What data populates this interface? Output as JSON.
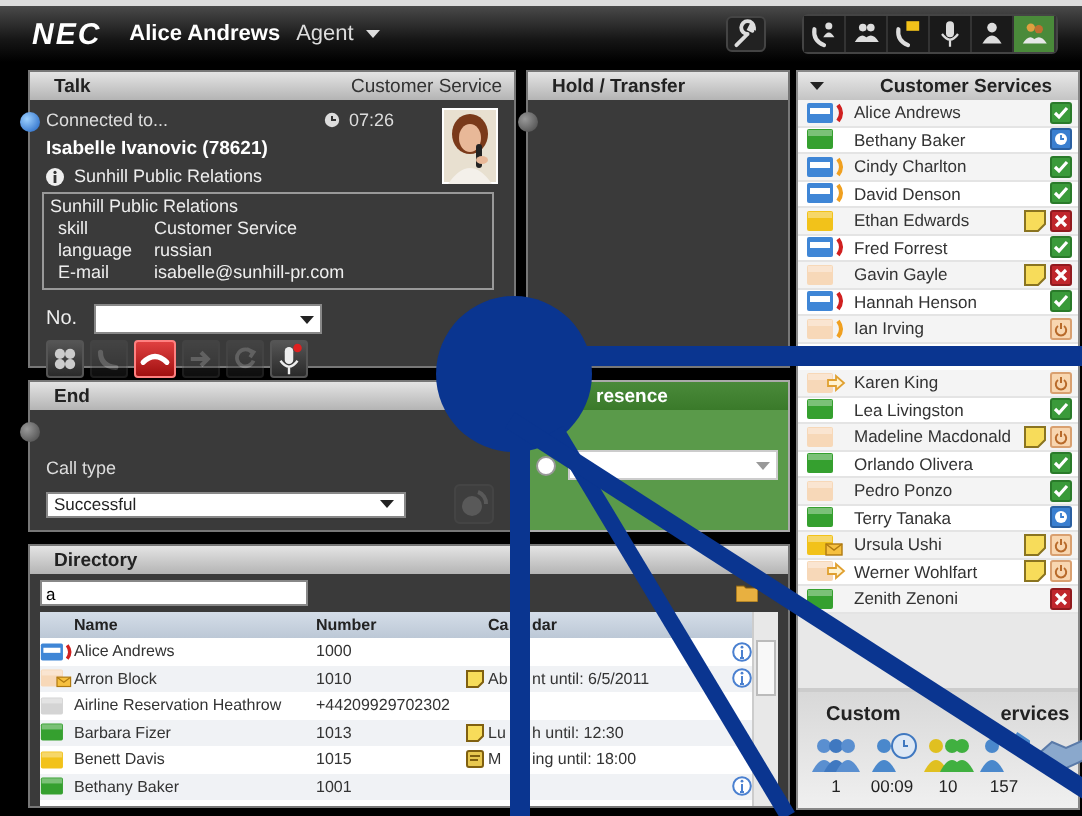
{
  "topbar": {
    "logo": "NEC",
    "user": "Alice Andrews",
    "role": "Agent",
    "tools": [
      {
        "kind": "wrench",
        "selected": false
      }
    ],
    "modes": [
      {
        "kind": "phone-person",
        "selected": false
      },
      {
        "kind": "group",
        "selected": false
      },
      {
        "kind": "phone-mail",
        "selected": false
      },
      {
        "kind": "mic",
        "selected": false
      },
      {
        "kind": "person",
        "selected": false
      },
      {
        "kind": "team",
        "selected": true
      }
    ]
  },
  "talk": {
    "title": "Talk",
    "queue": "Customer Service",
    "active": true,
    "status": "Connected to...",
    "duration": "07:26",
    "caller": "Isabelle Ivanovic (78621)",
    "company": "Sunhill Public Relations",
    "details": {
      "heading": "Sunhill Public Relations",
      "fields": [
        {
          "label": "skill",
          "value": "Customer Service"
        },
        {
          "label": "language",
          "value": "russian"
        },
        {
          "label": "E-mail",
          "value": "isabelle@sunhill-pr.com"
        }
      ]
    },
    "number_label": "No.",
    "controls": [
      {
        "kind": "dialpad",
        "disabled": false
      },
      {
        "kind": "answer",
        "disabled": true
      },
      {
        "kind": "hangup",
        "disabled": false
      },
      {
        "kind": "forward",
        "disabled": true
      },
      {
        "kind": "transfer",
        "disabled": true
      },
      {
        "kind": "mic",
        "disabled": false
      }
    ]
  },
  "hold": {
    "title": "Hold / Transfer",
    "active": false
  },
  "end": {
    "title": "End",
    "active": false,
    "call_type_label": "Call type",
    "call_type": "Successful",
    "button_disabled": true
  },
  "presence": {
    "title": "resence",
    "radio_checked": false
  },
  "directory": {
    "title": "Directory",
    "search": "a",
    "columns": [
      "Name",
      "Number"
    ],
    "calendar_column": [
      "Ca",
      "dar"
    ],
    "rows": [
      {
        "name": "Alice Andrews",
        "number": "1000",
        "color": "#3f86d6",
        "call": {
          "kind": "red"
        },
        "info": true
      },
      {
        "name": "Arron Block",
        "number": "1010",
        "color": "#f7d8b8",
        "call": {
          "kind": "mail"
        },
        "calendar": {
          "kind": "note",
          "parts": [
            "Ab",
            "nt until: 6/5/2011"
          ]
        },
        "info": true
      },
      {
        "name": "Airline Reservation Heathrow",
        "number": "+44209929702302",
        "color": "#d4d4d4",
        "info": false
      },
      {
        "name": "Barbara Fizer",
        "number": "1013",
        "color": "#35a02f",
        "calendar": {
          "kind": "note",
          "parts": [
            "Lu",
            "h until: 12:30"
          ]
        },
        "info": false
      },
      {
        "name": "Benett Davis",
        "number": "1015",
        "color": "#f2c21a",
        "calendar": {
          "kind": "meeting",
          "parts": [
            "M",
            "ing until: 18:00"
          ]
        },
        "info": false
      },
      {
        "name": "Bethany Baker",
        "number": "1001",
        "color": "#35a02f",
        "info": true
      }
    ]
  },
  "queue": {
    "title": "Customer Services",
    "expanded": true,
    "agents": [
      {
        "kind": "agent",
        "name": "Alice Andrews",
        "color": "#3f86d6",
        "call": {
          "kind": "red"
        },
        "note": false,
        "status": {
          "kind": "available"
        }
      },
      {
        "kind": "agent",
        "name": "Bethany Baker",
        "color": "#35a02f",
        "note": false,
        "status": {
          "kind": "scheduled"
        }
      },
      {
        "kind": "agent",
        "name": "Cindy Charlton",
        "color": "#3f86d6",
        "call": {
          "kind": "orange"
        },
        "note": false,
        "status": {
          "kind": "available"
        }
      },
      {
        "kind": "agent",
        "name": "David Denson",
        "color": "#3f86d6",
        "call": {
          "kind": "orange"
        },
        "note": false,
        "status": {
          "kind": "available"
        }
      },
      {
        "kind": "agent",
        "name": "Ethan Edwards",
        "color": "#f2c21a",
        "note": true,
        "status": {
          "kind": "busy"
        }
      },
      {
        "kind": "agent",
        "name": "Fred Forrest",
        "color": "#3f86d6",
        "call": {
          "kind": "red"
        },
        "note": false,
        "status": {
          "kind": "available"
        }
      },
      {
        "kind": "agent",
        "name": "Gavin Gayle",
        "color": "#f7d8b8",
        "note": true,
        "status": {
          "kind": "busy"
        }
      },
      {
        "kind": "agent",
        "name": "Hannah Henson",
        "color": "#3f86d6",
        "call": {
          "kind": "red"
        },
        "note": false,
        "status": {
          "kind": "available"
        }
      },
      {
        "kind": "agent",
        "name": "Ian Irving",
        "color": "#f7d8b8",
        "call": {
          "kind": "orange"
        },
        "note": false,
        "status": {
          "kind": "off"
        }
      },
      {
        "kind": "covered"
      },
      {
        "kind": "agent",
        "name": "Karen King",
        "color": "#f7d8b8",
        "call": {
          "kind": "forward"
        },
        "note": false,
        "status": {
          "kind": "off"
        }
      },
      {
        "kind": "agent",
        "name": "Lea Livingston",
        "color": "#35a02f",
        "note": false,
        "status": {
          "kind": "available"
        }
      },
      {
        "kind": "agent",
        "name": "Madeline Macdonald",
        "color": "#f7d8b8",
        "note": true,
        "status": {
          "kind": "off"
        }
      },
      {
        "kind": "agent",
        "name": "Orlando Olivera",
        "color": "#35a02f",
        "note": false,
        "status": {
          "kind": "available"
        }
      },
      {
        "kind": "agent",
        "name": "Pedro Ponzo",
        "color": "#f7d8b8",
        "note": false,
        "status": {
          "kind": "available"
        }
      },
      {
        "kind": "agent",
        "name": "Terry Tanaka",
        "color": "#35a02f",
        "note": false,
        "status": {
          "kind": "scheduled"
        }
      },
      {
        "kind": "agent",
        "name": "Ursula Ushi",
        "color": "#f2c21a",
        "call": {
          "kind": "mail"
        },
        "note": true,
        "status": {
          "kind": "off"
        }
      },
      {
        "kind": "agent",
        "name": "Werner Wohlfart",
        "color": "#f7d8b8",
        "call": {
          "kind": "forward"
        },
        "note": true,
        "status": {
          "kind": "off"
        }
      },
      {
        "kind": "agent",
        "name": "Zenith Zenoni",
        "color": "#35a02f",
        "note": false,
        "status": {
          "kind": "busy"
        }
      }
    ],
    "summary": {
      "title_parts": [
        "Custom",
        "ervices"
      ],
      "stats": [
        {
          "kind": "agents",
          "value": "1"
        },
        {
          "kind": "wait",
          "value": "00:09"
        },
        {
          "kind": "available",
          "value": "10"
        },
        {
          "kind": "calls",
          "value": "157"
        },
        {
          "kind": "handled"
        }
      ]
    }
  }
}
